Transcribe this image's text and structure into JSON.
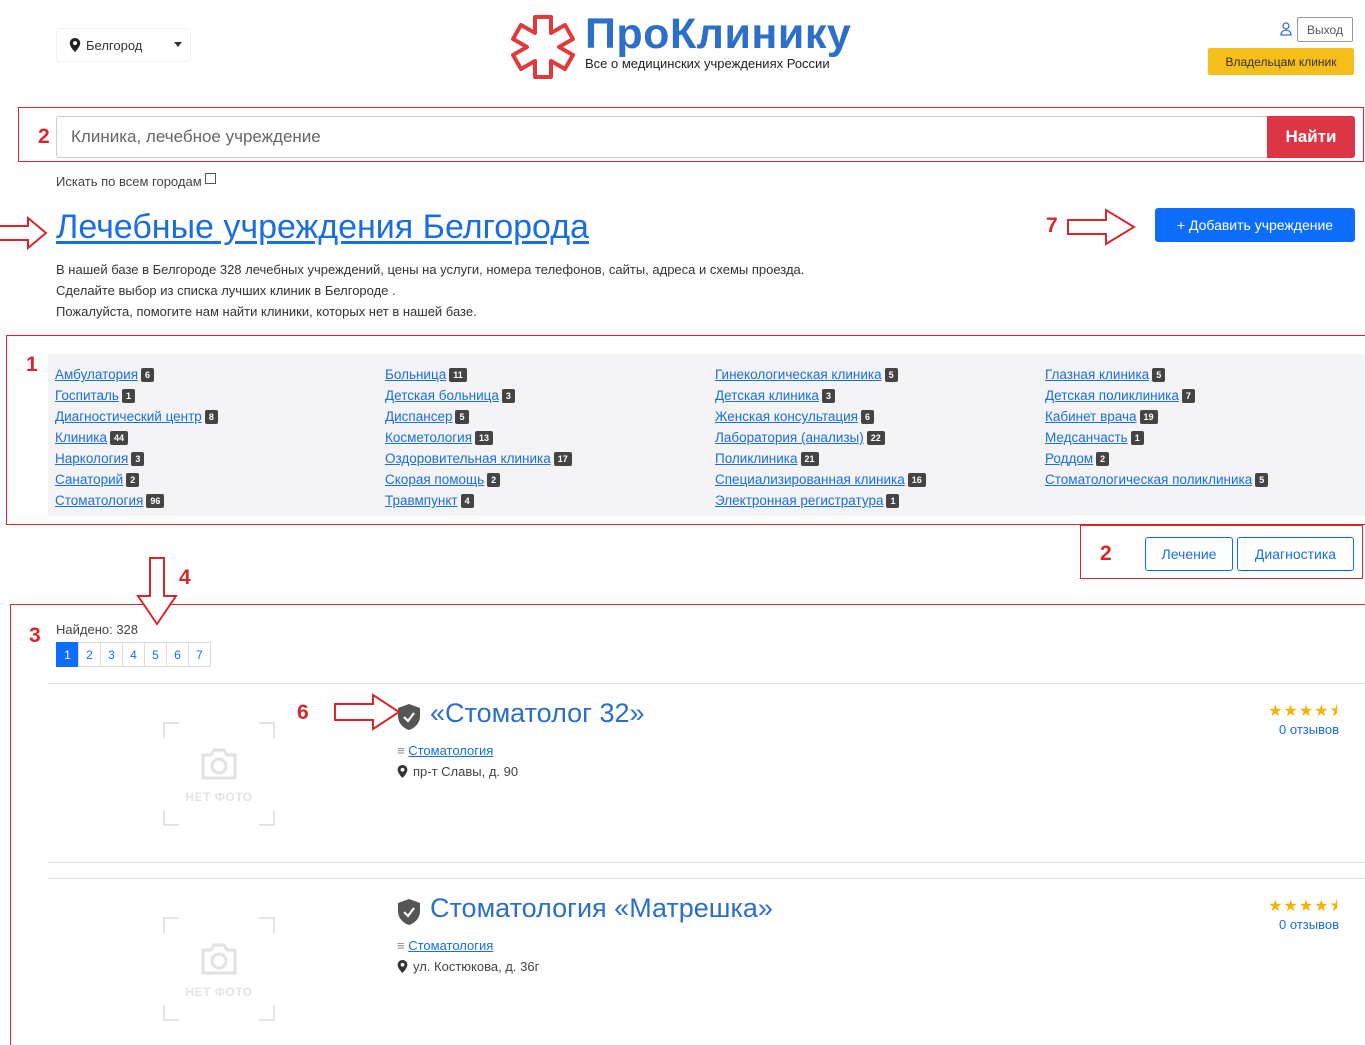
{
  "header": {
    "city": "Белгород",
    "logo_brand": "ПроКлинику",
    "logo_tagline": "Все о медицинских учреждениях России",
    "logout_label": "Выход",
    "owners_label": "Владельцам клиник"
  },
  "search": {
    "placeholder": "Клиника, лечебное учреждение",
    "button_label": "Найти",
    "all_cities_label": "Искать по всем городам"
  },
  "page": {
    "title": "Лечебные учреждения Белгорода",
    "add_label": "+ Добавить учреждение",
    "intro": [
      "В нашей базе в Белгороде 328 лечебных учреждений, цены на услуги, номера телефонов, сайты, адреса и схемы проезда.",
      "Сделайте выбор из списка лучших клиник в Белгороде .",
      "Пожалуйста, помогите нам найти клиники, которых нет в нашей базе."
    ]
  },
  "categories": [
    [
      {
        "label": "Амбулатория",
        "count": "6"
      },
      {
        "label": "Госпиталь",
        "count": "1"
      },
      {
        "label": "Диагностический центр",
        "count": "8"
      },
      {
        "label": "Клиника",
        "count": "44"
      },
      {
        "label": "Наркология",
        "count": "3"
      },
      {
        "label": "Санаторий",
        "count": "2"
      },
      {
        "label": "Стоматология",
        "count": "96"
      }
    ],
    [
      {
        "label": "Больница",
        "count": "11"
      },
      {
        "label": "Детская больница",
        "count": "3"
      },
      {
        "label": "Диспансер",
        "count": "5"
      },
      {
        "label": "Косметология",
        "count": "13"
      },
      {
        "label": "Оздоровительная клиника",
        "count": "17"
      },
      {
        "label": "Скорая помощь",
        "count": "2"
      },
      {
        "label": "Травмпункт",
        "count": "4"
      }
    ],
    [
      {
        "label": "Гинекологическая клиника",
        "count": "5"
      },
      {
        "label": "Детская клиника",
        "count": "3"
      },
      {
        "label": "Женская консультация",
        "count": "6"
      },
      {
        "label": "Лаборатория (анализы)",
        "count": "22"
      },
      {
        "label": "Поликлиника",
        "count": "21"
      },
      {
        "label": "Специализированная клиника",
        "count": "16"
      },
      {
        "label": "Электронная регистратура",
        "count": "1"
      }
    ],
    [
      {
        "label": "Глазная клиника",
        "count": "5"
      },
      {
        "label": "Детская поликлиника",
        "count": "7"
      },
      {
        "label": "Кабинет врача",
        "count": "19"
      },
      {
        "label": "Медсанчасть",
        "count": "1"
      },
      {
        "label": "Роддом",
        "count": "2"
      },
      {
        "label": "Стоматологическая поликлиника",
        "count": "5"
      }
    ]
  ],
  "filters": {
    "treatment": "Лечение",
    "diagnostics": "Диагностика"
  },
  "results": {
    "found": "Найдено: 328",
    "pages": [
      "1",
      "2",
      "3",
      "4",
      "5",
      "6",
      "7"
    ],
    "active_page": "1",
    "no_photo": "НЕТ ФОТО",
    "items": [
      {
        "title": "«Стоматолог 32»",
        "category": "Стоматология",
        "address": "пр-т Славы, д. 90",
        "rating": 4.5,
        "reviews": "0 отзывов"
      },
      {
        "title": "Стоматология «Матрешка»",
        "category": "Стоматология",
        "address": "ул. Костюкова, д. 36г",
        "rating": 4.5,
        "reviews": "0 отзывов"
      }
    ]
  },
  "annotations": {
    "n1": "1",
    "n2": "2",
    "n3": "3",
    "n4": "4",
    "n6": "6",
    "n7": "7"
  },
  "colors": {
    "accent": "#0d6efd",
    "danger": "#dc3545",
    "warning": "#f5be1a",
    "annotation": "#d9262c",
    "link": "#1a6ee0"
  }
}
